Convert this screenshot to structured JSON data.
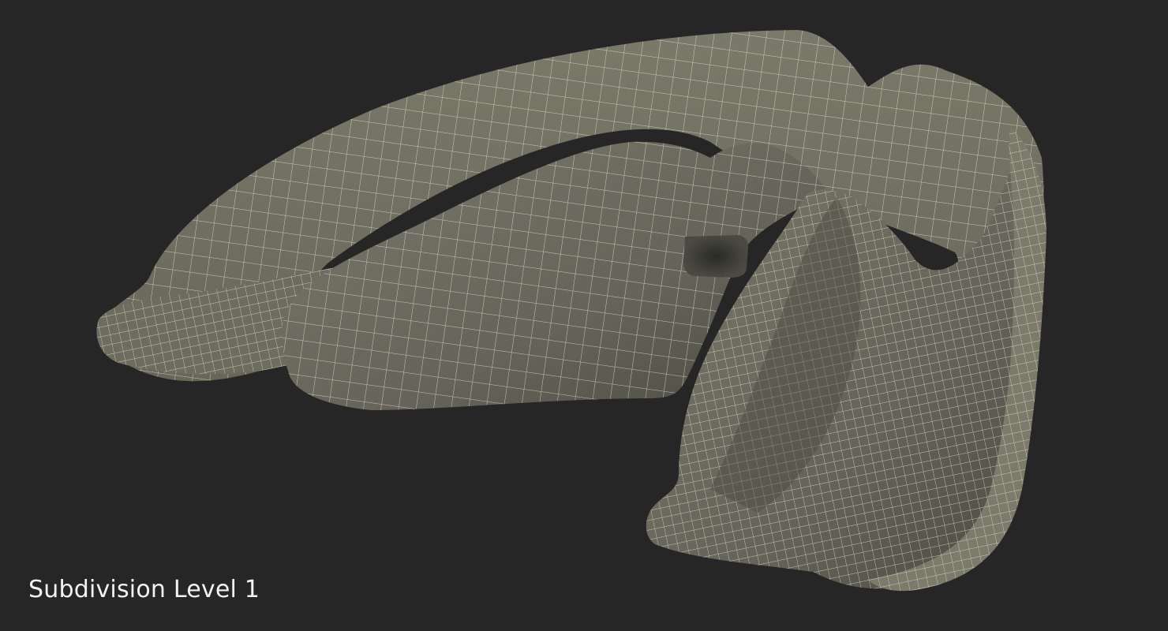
{
  "caption": "Subdivision Level 1",
  "colors": {
    "background": "#262626",
    "surface": "#6f6d5f",
    "surface_shadow": "#3f3e36",
    "wire": "#e9e6d2",
    "caption": "#f2f2f2"
  }
}
